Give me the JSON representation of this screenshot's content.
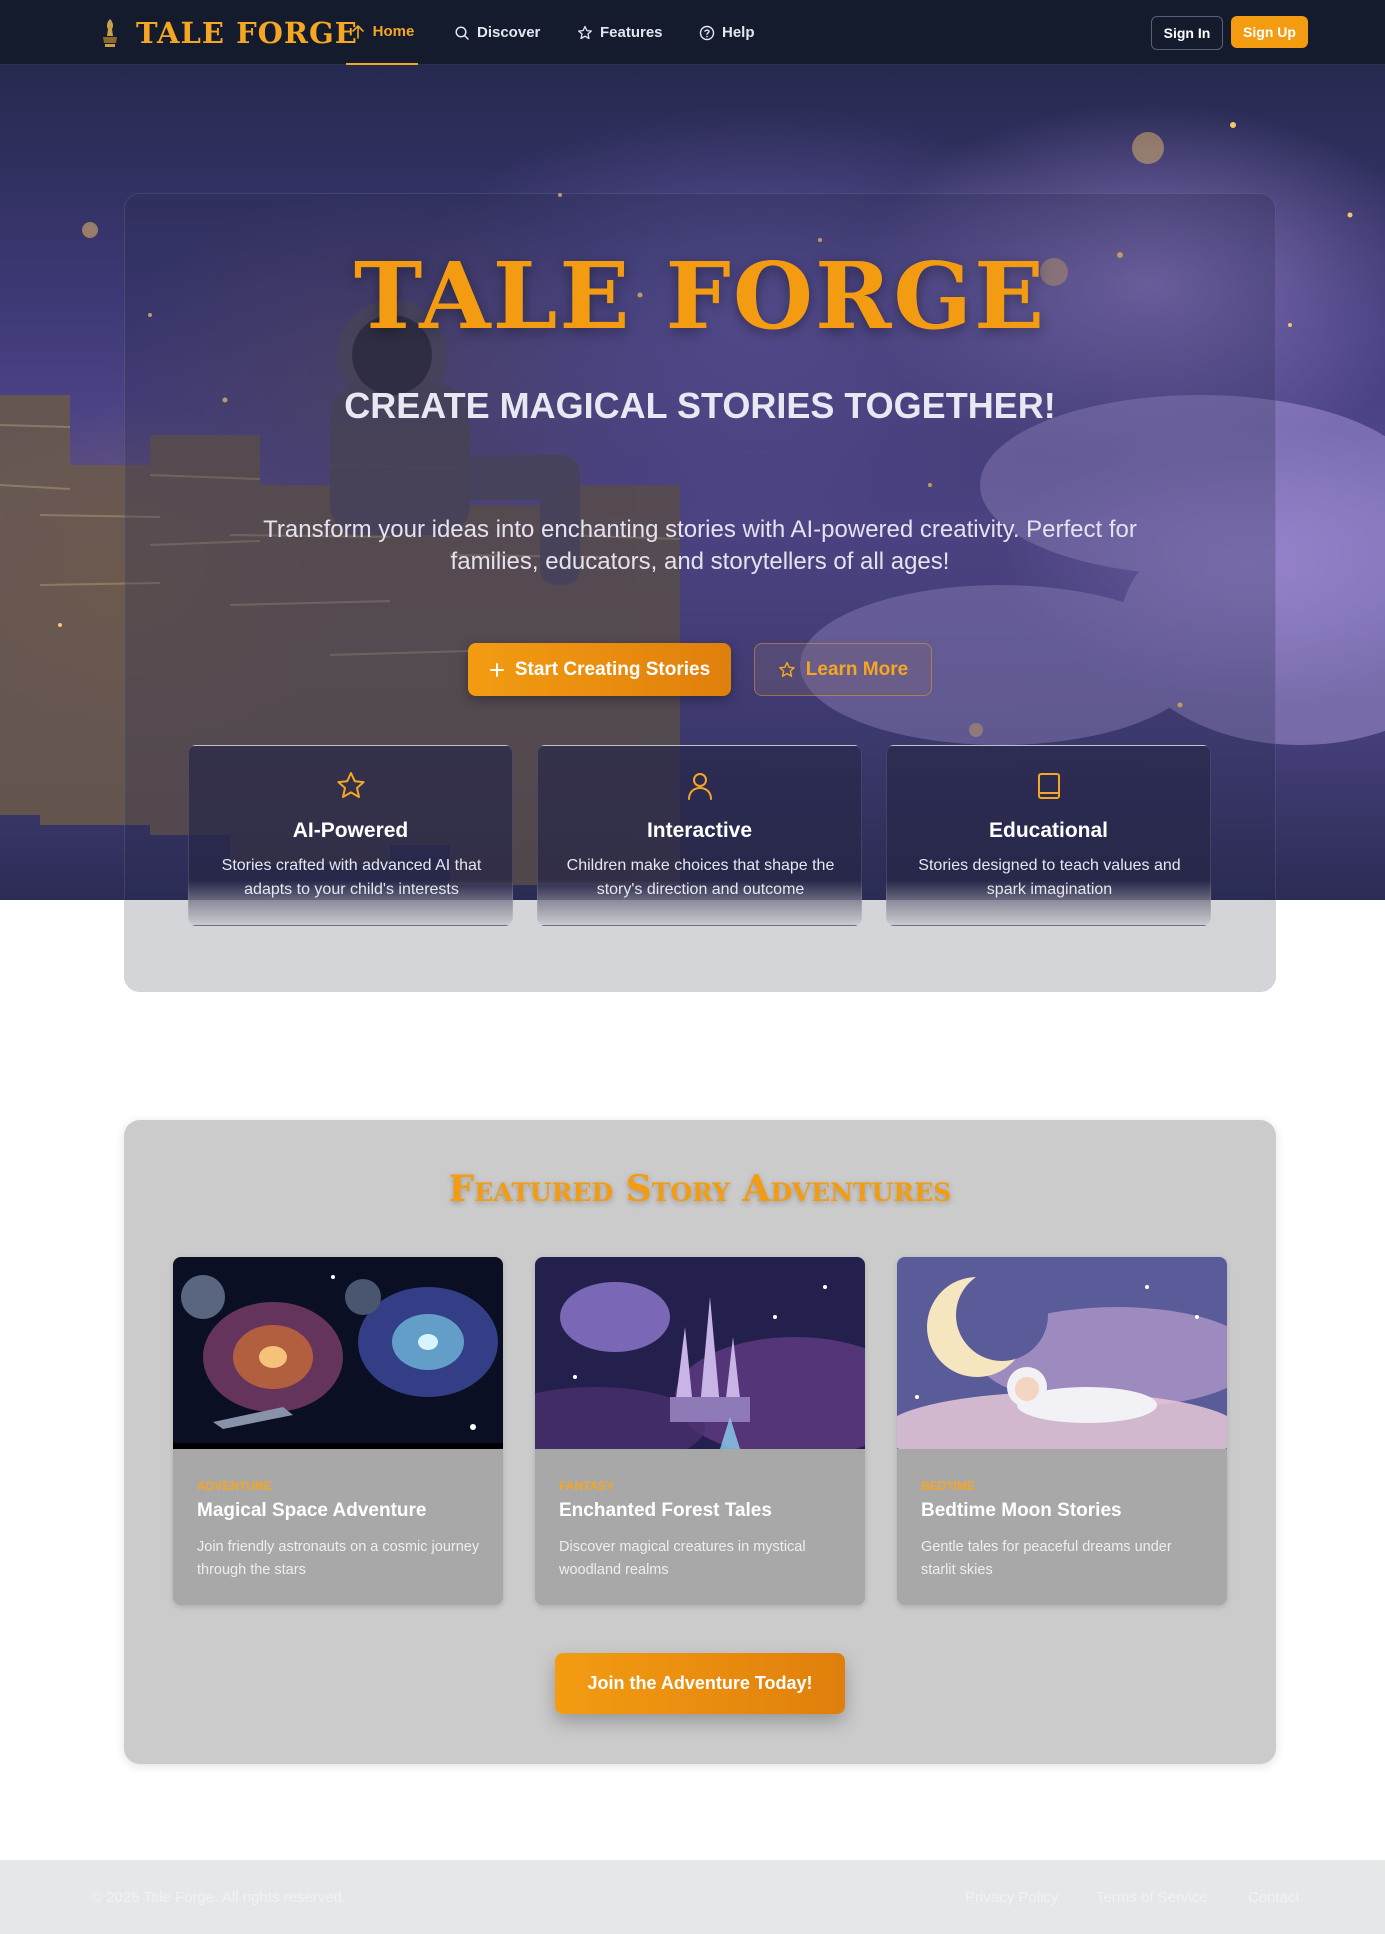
{
  "nav": {
    "brand": "TALE FORGE",
    "links": [
      {
        "label": "Home",
        "icon": "home-icon",
        "active": true
      },
      {
        "label": "Discover",
        "icon": "search-icon",
        "active": false
      },
      {
        "label": "Features",
        "icon": "star-icon",
        "active": false
      },
      {
        "label": "Help",
        "icon": "help-circle-icon",
        "active": false
      }
    ],
    "signin": "Sign In",
    "signup": "Sign Up"
  },
  "hero": {
    "title": "TALE FORGE",
    "subtitle": "CREATE MAGICAL STORIES TOGETHER!",
    "description": "Transform your ideas into enchanting stories with AI-powered creativity. Perfect for families, educators, and storytellers of all ages!",
    "primary_cta": "Start Creating Stories",
    "secondary_cta": "Learn More"
  },
  "features": [
    {
      "icon": "star-icon",
      "title": "AI-Powered",
      "description": "Stories crafted with advanced AI that adapts to your child's interests"
    },
    {
      "icon": "user-icon",
      "title": "Interactive",
      "description": "Children make choices that shape the story's direction and outcome"
    },
    {
      "icon": "book-icon",
      "title": "Educational",
      "description": "Stories designed to teach values and spark imagination"
    }
  ],
  "featured": {
    "title": "Featured Story Adventures",
    "cards": [
      {
        "category": "ADVENTURE",
        "title": "Magical Space Adventure",
        "description": "Join friendly astronauts on a cosmic journey through the stars"
      },
      {
        "category": "FANTASY",
        "title": "Enchanted Forest Tales",
        "description": "Discover magical creatures in mystical woodland realms"
      },
      {
        "category": "BEDTIME",
        "title": "Bedtime Moon Stories",
        "description": "Gentle tales for peaceful dreams under starlit skies"
      }
    ],
    "cta": "Join the Adventure Today!"
  },
  "footer": {
    "copyright": "© 2025 Tale Forge. All rights reserved.",
    "links": [
      "Privacy Policy",
      "Terms of Service",
      "Contact"
    ]
  },
  "colors": {
    "accent": "#f39c12",
    "nav_bg": "#141b2d"
  }
}
